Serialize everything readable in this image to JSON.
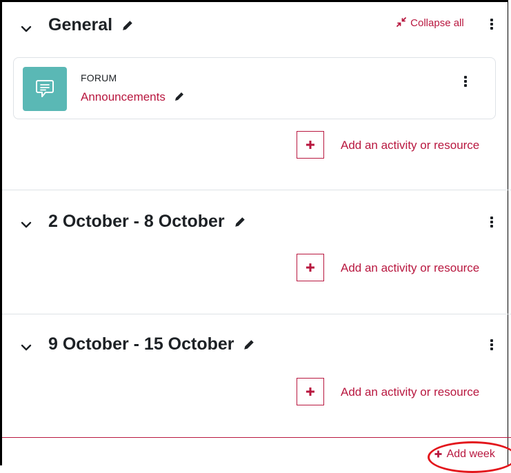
{
  "colors": {
    "accent": "#b8173f",
    "forum_icon_bg": "#5ab8b5",
    "highlight": "#e3161c",
    "divider": "#dee2e6"
  },
  "header": {
    "collapse_all_label": "Collapse all"
  },
  "sections": [
    {
      "title": "General",
      "activities": [
        {
          "type": "FORUM",
          "name": "Announcements",
          "icon": "forum-icon"
        }
      ],
      "add_activity_label": "Add an activity or resource"
    },
    {
      "title": "2 October - 8 October",
      "add_activity_label": "Add an activity or resource"
    },
    {
      "title": "9 October - 15 October",
      "add_activity_label": "Add an activity or resource"
    }
  ],
  "footer": {
    "add_week_label": "Add week"
  }
}
